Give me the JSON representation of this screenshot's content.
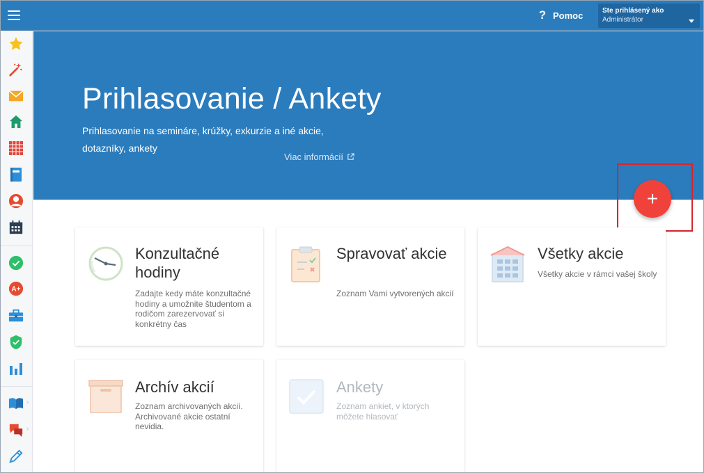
{
  "topbar": {
    "help_label": "Pomoc",
    "help_glyph": "?",
    "user_caption": "Ste prihlásený ako",
    "user_role": "Administrátor"
  },
  "sidebar": {
    "icons": [
      "star-icon",
      "magic-wand-icon",
      "mail-icon",
      "home-icon",
      "timetable-icon",
      "notebook-icon",
      "user-icon",
      "calendar-icon",
      "check-circle-icon",
      "grade-icon",
      "briefcase-icon",
      "shield-check-icon",
      "chart-icon",
      "book-icon",
      "chat-icon",
      "pen-icon"
    ]
  },
  "hero": {
    "title": "Prihlasovanie / Ankety",
    "subtitle": "Prihlasovanie na semináre, krúžky, exkurzie a iné akcie, dotazníky, ankety",
    "more_link": "Viac informácií"
  },
  "fab": {
    "label": "+"
  },
  "cards": [
    {
      "title": "Konzultačné hodiny",
      "desc": "Zadajte kedy máte konzultačné hodiny a umožnite študentom a rodičom zarezervovať si konkrétny čas",
      "icon": "clock-icon"
    },
    {
      "title": "Spravovať akcie",
      "desc": "Zoznam Vami vytvorených akcií",
      "icon": "clipboard-icon"
    },
    {
      "title": "Všetky akcie",
      "desc": "Všetky akcie v rámci vašej školy",
      "icon": "building-icon"
    },
    {
      "title": "Archív akcií",
      "desc": "Zoznam archivovaných akcií. Archivované akcie ostatní nevidia.",
      "icon": "archive-box-icon"
    },
    {
      "title": "Ankety",
      "desc": "Zoznam ankiet, v ktorých môžete hlasovať",
      "icon": "checkbox-icon"
    }
  ],
  "colors": {
    "primary": "#2b7cbd",
    "fab": "#f0423a",
    "highlight": "#d6252c"
  }
}
